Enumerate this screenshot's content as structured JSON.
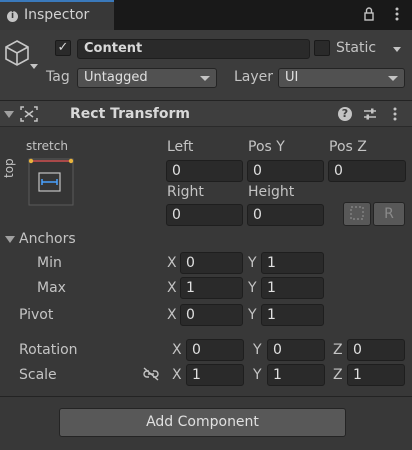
{
  "tab": {
    "icon": "info-icon",
    "title": "Inspector"
  },
  "toolbar": {
    "lock_icon": "lock-icon",
    "menu_icon": "kebab-menu-icon"
  },
  "gameobject": {
    "icon": "cube-icon",
    "active": true,
    "name": "Content",
    "static_label": "Static",
    "static": false,
    "tag_label": "Tag",
    "tag_value": "Untagged",
    "layer_label": "Layer",
    "layer_value": "UI"
  },
  "rect_transform": {
    "icon": "rect-transform-icon",
    "title": "Rect Transform",
    "help_icon": "help-icon",
    "preset_icon": "preset-sliders-icon",
    "menu_icon": "kebab-menu-icon",
    "anchor_preset": {
      "h_label": "stretch",
      "v_label": "top"
    },
    "fields": {
      "left_label": "Left",
      "left": "0",
      "posy_label": "Pos Y",
      "posy": "0",
      "posz_label": "Pos Z",
      "posz": "0",
      "right_label": "Right",
      "right": "0",
      "height_label": "Height",
      "height": "0"
    },
    "blueprint_icon": "blueprint-mode-icon",
    "raw_edit_label": "R",
    "anchors": {
      "label": "Anchors",
      "min_label": "Min",
      "min_x": "0",
      "min_y": "1",
      "max_label": "Max",
      "max_x": "1",
      "max_y": "1"
    },
    "pivot": {
      "label": "Pivot",
      "x": "0",
      "y": "1"
    },
    "rotation": {
      "label": "Rotation",
      "x": "0",
      "y": "0",
      "z": "0"
    },
    "scale": {
      "label": "Scale",
      "link_icon": "constrain-proportions-icon",
      "x": "1",
      "y": "1",
      "z": "1"
    },
    "axis": {
      "x": "X",
      "y": "Y",
      "z": "Z"
    }
  },
  "add_component_label": "Add Component"
}
